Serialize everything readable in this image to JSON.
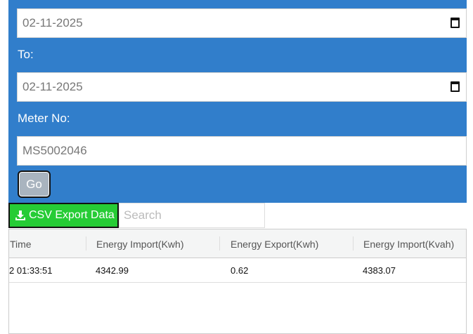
{
  "form": {
    "from_value": "02-11-2025",
    "to_label": "To:",
    "to_value": "02-11-2025",
    "meter_label": "Meter No:",
    "meter_value": "MS5002046",
    "go_label": "Go"
  },
  "toolbar": {
    "csv_label": "CSV Export Data",
    "search_placeholder": "Search"
  },
  "table": {
    "headers": [
      "Time",
      "Energy Import(Kwh)",
      "Energy Export(Kwh)",
      "Energy Import(Kvah)"
    ],
    "rows": [
      [
        "2 01:33:51",
        "4342.99",
        "0.62",
        "4383.07"
      ]
    ]
  },
  "colors": {
    "panel": "#317ecb",
    "csv_button": "#26cc35"
  }
}
